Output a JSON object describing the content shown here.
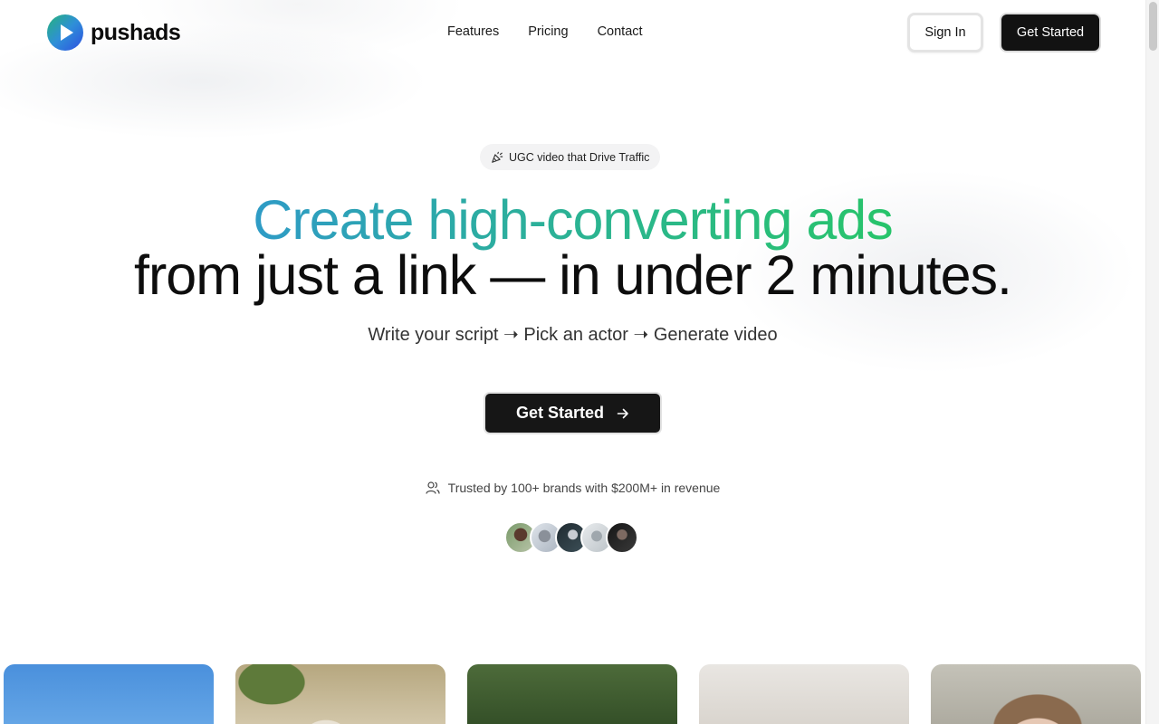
{
  "brand": {
    "name": "pushads",
    "logo_icon": "play-logo-icon",
    "gradient": [
      "#2f8fd8",
      "#2d5be0"
    ]
  },
  "nav": {
    "links": [
      {
        "label": "Features"
      },
      {
        "label": "Pricing"
      },
      {
        "label": "Contact"
      }
    ]
  },
  "header": {
    "signin_label": "Sign In",
    "cta_label": "Get Started"
  },
  "hero": {
    "badge_icon": "party-popper-icon",
    "badge_text": "UGC video that Drive Traffic",
    "headline_line1": "Create high-converting ads",
    "headline_line2": "from just a link — in under 2 minutes.",
    "subhead": "Write your script ➝ Pick an actor ➝ Generate video",
    "cta_label": "Get Started",
    "cta_icon": "arrow-right-icon",
    "trusted_icon": "users-icon",
    "trusted_text": "Trusted by 100+ brands with $200M+ in revenue",
    "accent_gradient": [
      "#2e9bc6",
      "#27c46a"
    ]
  },
  "avatars": [
    {
      "name": "avatar-1"
    },
    {
      "name": "avatar-2"
    },
    {
      "name": "avatar-3"
    },
    {
      "name": "avatar-4"
    },
    {
      "name": "avatar-5"
    }
  ],
  "video_cards": [
    {
      "name": "video-card-1"
    },
    {
      "name": "video-card-2"
    },
    {
      "name": "video-card-3"
    },
    {
      "name": "video-card-4"
    },
    {
      "name": "video-card-5"
    }
  ]
}
